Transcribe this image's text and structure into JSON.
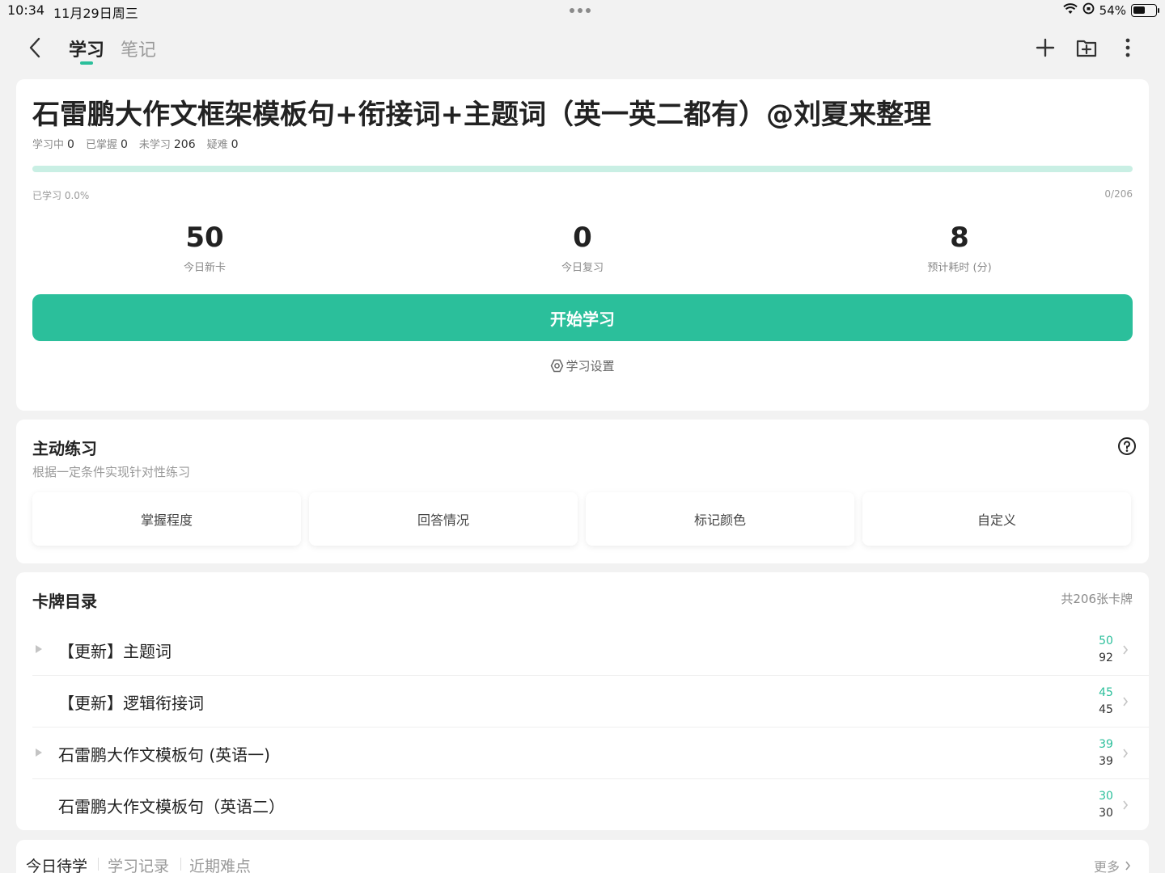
{
  "status_bar": {
    "time": "10:34",
    "date": "11月29日周三",
    "battery": "54%",
    "battery_level": 0.54
  },
  "nav": {
    "tabs": [
      {
        "label": "学习",
        "active": true
      },
      {
        "label": "笔记",
        "active": false
      }
    ],
    "icons": [
      "back-icon",
      "plus-icon",
      "folder-add-icon",
      "more-vertical-icon"
    ]
  },
  "deck": {
    "title": "石雷鹏大作文框架模板句+衔接词+主题词（英一英二都有）@刘夏来整理",
    "stats": [
      {
        "label": "学习中",
        "value": "0"
      },
      {
        "label": "已掌握",
        "value": "0"
      },
      {
        "label": "未学习",
        "value": "206"
      },
      {
        "label": "疑难",
        "value": "0"
      }
    ],
    "progress_label": "已学习 0.0%",
    "progress_count": "0/206",
    "progress_fraction": 0.0,
    "metrics": [
      {
        "value": "50",
        "label": "今日新卡"
      },
      {
        "value": "0",
        "label": "今日复习"
      },
      {
        "value": "8",
        "label": "预计耗时 (分)"
      }
    ],
    "start_button": "开始学习",
    "settings_link": "学习设置"
  },
  "practice": {
    "title": "主动练习",
    "subtitle": "根据一定条件实现针对性练习",
    "buttons": [
      "掌握程度",
      "回答情况",
      "标记颜色",
      "自定义"
    ]
  },
  "catalog": {
    "title": "卡牌目录",
    "total": "共206张卡牌",
    "rows": [
      {
        "label": "【更新】主题词",
        "new": "50",
        "total": "92",
        "expandable": true
      },
      {
        "label": "【更新】逻辑衔接词",
        "new": "45",
        "total": "45",
        "expandable": false
      },
      {
        "label": "石雷鹏大作文模板句 (英语一)",
        "new": "39",
        "total": "39",
        "expandable": true
      },
      {
        "label": "石雷鹏大作文模板句（英语二）",
        "new": "30",
        "total": "30",
        "expandable": false
      }
    ]
  },
  "bottom": {
    "tabs": [
      {
        "label": "今日待学",
        "active": true
      },
      {
        "label": "学习记录",
        "active": false
      },
      {
        "label": "近期难点",
        "active": false
      }
    ],
    "more": "更多"
  },
  "colors": {
    "accent": "#2bbf9b",
    "background": "#f2f2f2"
  }
}
